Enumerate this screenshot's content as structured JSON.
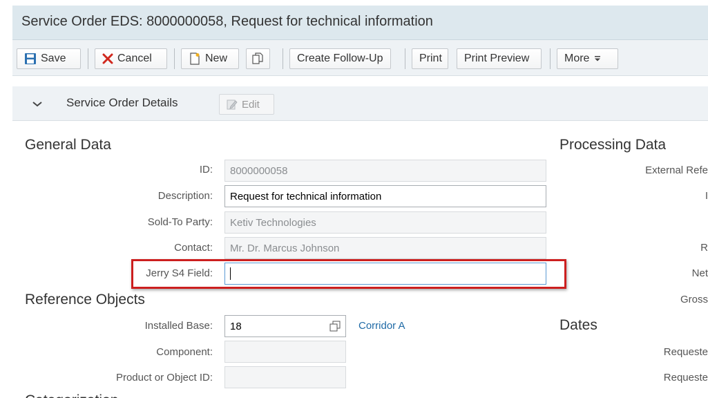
{
  "window": {
    "title": "Service Order EDS: 8000000058, Request for technical information"
  },
  "toolbar": {
    "save_label": "Save",
    "cancel_label": "Cancel",
    "new_label": "New",
    "create_follow_up_label": "Create Follow-Up",
    "print_label": "Print",
    "print_preview_label": "Print Preview",
    "more_label": "More"
  },
  "section": {
    "title": "Service Order Details",
    "edit_label": "Edit"
  },
  "general_data": {
    "title": "General Data",
    "fields": [
      {
        "label": "ID:",
        "value": "8000000058"
      },
      {
        "label": "Description:",
        "value": "Request for technical information"
      },
      {
        "label": "Sold-To Party:",
        "value": "Ketiv Technologies"
      },
      {
        "label": "Contact:",
        "value": "Mr. Dr. Marcus Johnson"
      },
      {
        "label": "Jerry S4 Field:",
        "value": ""
      }
    ]
  },
  "reference_objects": {
    "title": "Reference Objects",
    "fields": [
      {
        "label": "Installed Base:",
        "value": "18",
        "link": "Corridor A"
      },
      {
        "label": "Component:",
        "value": ""
      },
      {
        "label": "Product or Object ID:",
        "value": ""
      }
    ],
    "next_title_partial": "Categorization"
  },
  "processing_data": {
    "title": "Processing Data",
    "labels": [
      "External Refe",
      "I",
      "R",
      "Net",
      "Gross"
    ]
  },
  "dates": {
    "title": "Dates",
    "labels": [
      "Requeste",
      "Requeste"
    ]
  },
  "colors": {
    "accent": "#1f6aa6",
    "highlight": "#cc1f1f",
    "cancel": "#d0271d",
    "save": "#2a6fb0"
  }
}
